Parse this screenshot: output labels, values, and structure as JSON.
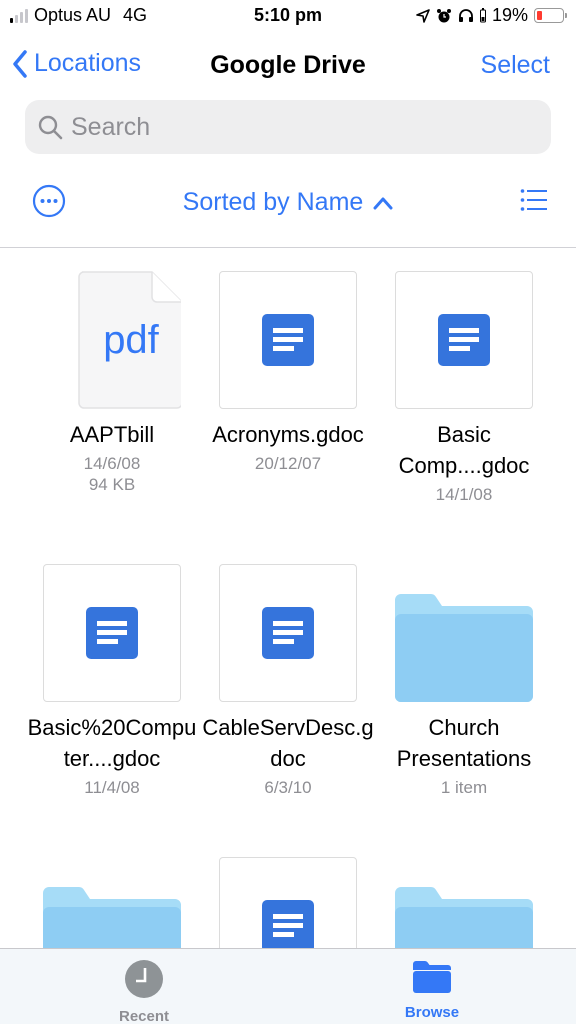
{
  "status_bar": {
    "carrier": "Optus AU",
    "network": "4G",
    "time": "5:10 pm",
    "battery_percent": "19%",
    "battery_level": 0.19,
    "signal_bars_active": 1,
    "signal_bars_total": 4,
    "icons": [
      "location-arrow-icon",
      "alarm-icon",
      "headphones-icon",
      "battery-icon"
    ]
  },
  "nav": {
    "back_label": "Locations",
    "title": "Google Drive",
    "select_label": "Select"
  },
  "search": {
    "placeholder": "Search",
    "value": ""
  },
  "sort": {
    "label": "Sorted by Name",
    "direction": "ascending"
  },
  "items": [
    {
      "name": "AAPTbill",
      "type": "pdf",
      "thumb_label": "pdf",
      "meta": [
        "14/6/08",
        "94 KB"
      ]
    },
    {
      "name": "Acronyms.gdoc",
      "type": "gdoc",
      "meta": [
        "20/12/07"
      ]
    },
    {
      "name": "Basic Comp....gdoc",
      "type": "gdoc",
      "meta": [
        "14/1/08"
      ]
    },
    {
      "name": "Basic%20Computer....gdoc",
      "type": "gdoc",
      "meta": [
        "11/4/08"
      ]
    },
    {
      "name": "CableServDesc.gdoc",
      "type": "gdoc",
      "meta": [
        "6/3/10"
      ]
    },
    {
      "name": "Church Presentations",
      "type": "folder",
      "meta": [
        "1 item"
      ]
    },
    {
      "name": "",
      "type": "folder",
      "meta": []
    },
    {
      "name": "",
      "type": "gdoc",
      "meta": []
    },
    {
      "name": "",
      "type": "folder",
      "meta": []
    }
  ],
  "tabs": [
    {
      "label": "Recent",
      "icon": "clock-icon",
      "active": false
    },
    {
      "label": "Browse",
      "icon": "folder-icon",
      "active": true
    }
  ],
  "colors": {
    "accent": "#3478f6",
    "gdoc": "#3574dc",
    "folder": "#8ecdf3",
    "battery_low": "#ff3b30"
  }
}
